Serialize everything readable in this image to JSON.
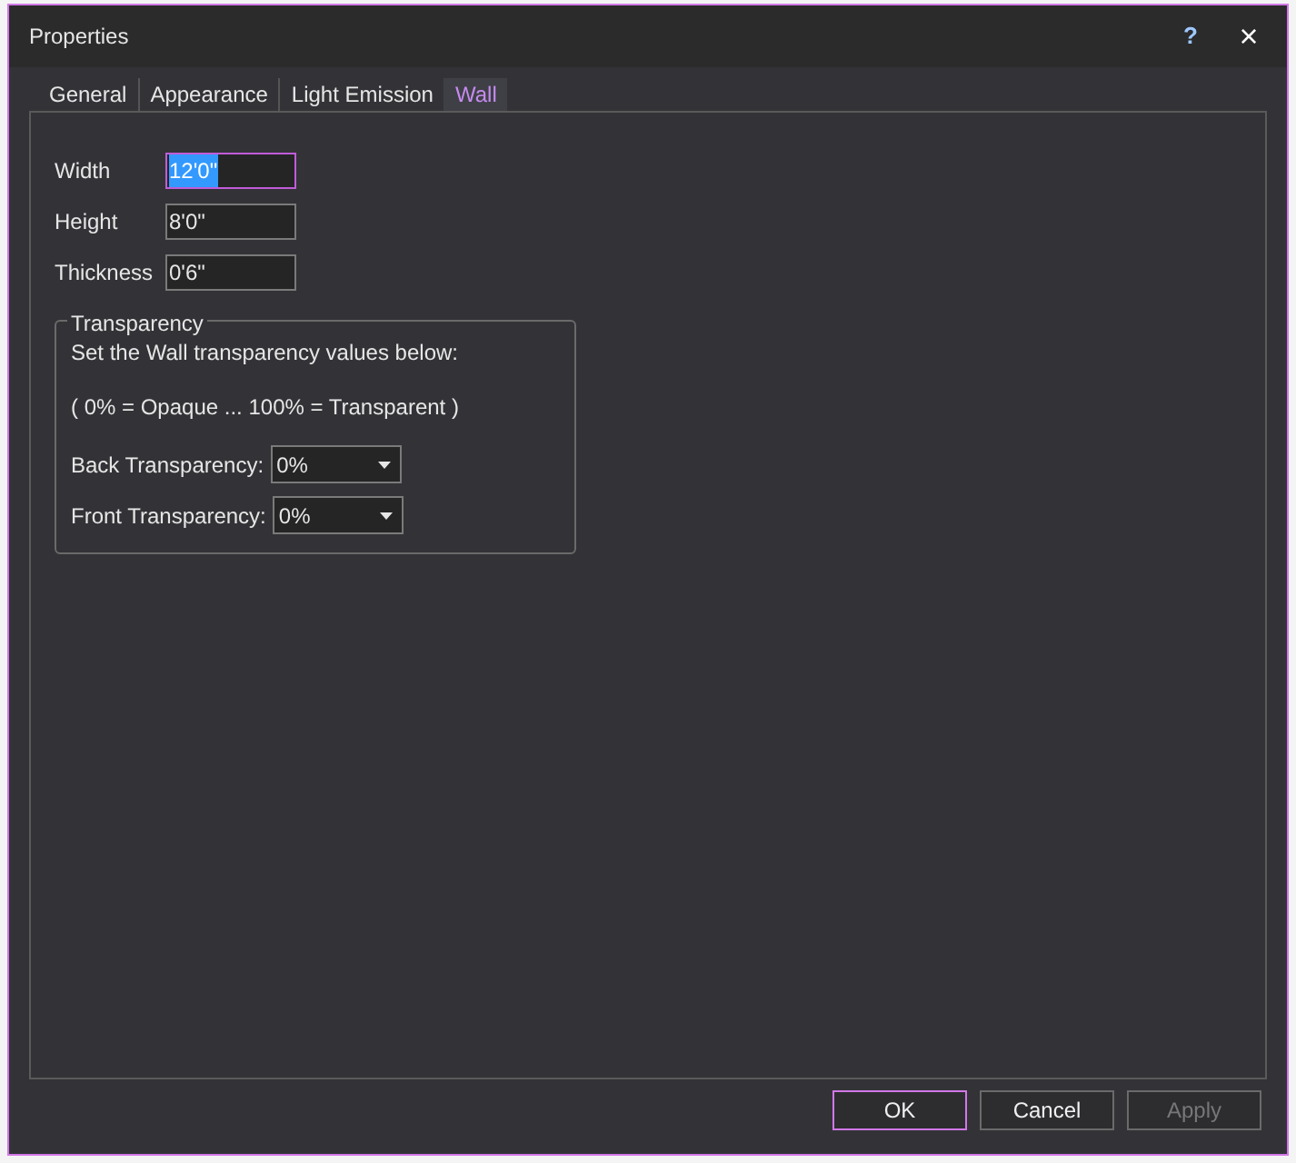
{
  "window": {
    "title": "Properties",
    "help": "?",
    "close": "×"
  },
  "tabs": [
    {
      "label": "General",
      "selected": false
    },
    {
      "label": "Appearance",
      "selected": false
    },
    {
      "label": "Light Emission",
      "selected": false
    },
    {
      "label": "Wall",
      "selected": true
    }
  ],
  "fields": [
    {
      "label": "Width",
      "value": "12'0\"",
      "focused": true
    },
    {
      "label": "Height",
      "value": "8'0\"",
      "focused": false
    },
    {
      "label": "Thickness",
      "value": "0'6\"",
      "focused": false
    }
  ],
  "transparency": {
    "title": "Transparency",
    "intro": "Set the Wall transparency values below:",
    "legend": "( 0% = Opaque ... 100% = Transparent )",
    "dropdowns": [
      {
        "label": "Back Transparency:",
        "value": "0%"
      },
      {
        "label": "Front Transparency:",
        "value": "0%"
      }
    ]
  },
  "buttons": [
    {
      "label": "OK",
      "default": true,
      "disabled": false
    },
    {
      "label": "Cancel",
      "default": false,
      "disabled": false
    },
    {
      "label": "Apply",
      "default": false,
      "disabled": true
    }
  ]
}
